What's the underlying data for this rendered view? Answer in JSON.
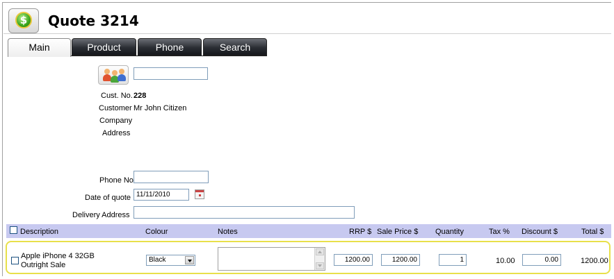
{
  "header": {
    "title": "Quote 3214",
    "logo_icon": "dollar-coin-icon"
  },
  "tabs": [
    {
      "label": "Main",
      "active": true
    },
    {
      "label": "Product",
      "active": false
    },
    {
      "label": "Phone",
      "active": false
    },
    {
      "label": "Search",
      "active": false
    }
  ],
  "customer": {
    "search_value": "",
    "cust_no_label": "Cust. No.",
    "cust_no_value": "228",
    "customer_label": "Customer",
    "customer_value": "Mr John Citizen",
    "company_label": "Company",
    "company_value": "",
    "address_label": "Address",
    "address_value": ""
  },
  "form": {
    "phone_label": "Phone No",
    "phone_value": "",
    "date_label": "Date of quote",
    "date_value": "11/11/2010",
    "delivery_label": "Delivery Address",
    "delivery_value": ""
  },
  "table": {
    "columns": {
      "description": "Description",
      "colour": "Colour",
      "notes": "Notes",
      "rrp": "RRP $",
      "sale_price": "Sale Price $",
      "quantity": "Quantity",
      "tax": "Tax %",
      "discount": "Discount $",
      "total": "Total $"
    },
    "rows": [
      {
        "description_line1": "Apple iPhone 4 32GB",
        "description_line2": "Outright Sale",
        "colour": "Black",
        "notes": "",
        "rrp": "1200.00",
        "sale_price": "1200.00",
        "quantity": "1",
        "tax": "10.00",
        "discount": "0.00",
        "total": "1200.00"
      }
    ]
  },
  "colors": {
    "header_bg": "#c7c9f0",
    "highlight_border": "#e8e04a"
  }
}
